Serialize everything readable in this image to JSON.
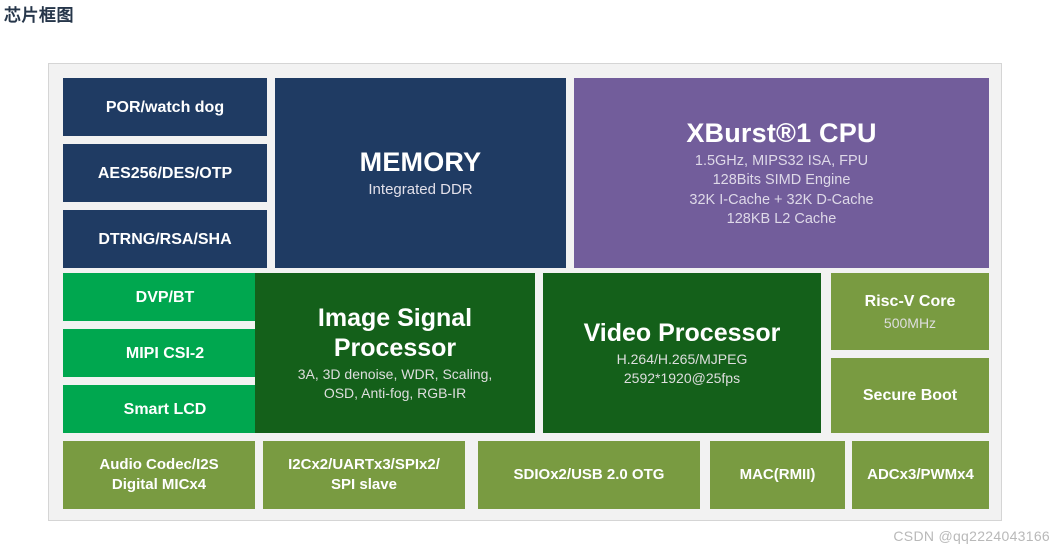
{
  "page": {
    "title": "芯片框图",
    "watermark": "CSDN @qq2224043166"
  },
  "colors": {
    "navy": "#1f3b63",
    "green": "#00a74f",
    "dark_green": "#14601a",
    "purple": "#725d9b",
    "olive": "#799b41",
    "canvas": "#f2f2f2",
    "title_text": "#26364a",
    "watermark_text": "#b9b9b9"
  },
  "diagram": {
    "left_security_blocks": [
      {
        "label": "POR/watch dog"
      },
      {
        "label": "AES256/DES/OTP"
      },
      {
        "label": "DTRNG/RSA/SHA"
      }
    ],
    "left_interface_blocks": [
      {
        "label": "DVP/BT"
      },
      {
        "label": "MIPI CSI-2"
      },
      {
        "label": "Smart LCD"
      }
    ],
    "memory": {
      "title": "MEMORY",
      "subtitle": "Integrated DDR"
    },
    "cpu": {
      "title": "XBurst®1 CPU",
      "specs": [
        "1.5GHz, MIPS32 ISA, FPU",
        "128Bits SIMD Engine",
        "32K I-Cache + 32K D-Cache",
        "128KB L2 Cache"
      ]
    },
    "isp": {
      "title_line1": "Image Signal",
      "title_line2": "Processor",
      "specs": [
        "3A, 3D denoise, WDR, Scaling,",
        "OSD, Anti-fog, RGB-IR"
      ]
    },
    "video": {
      "title": "Video Processor",
      "specs": [
        "H.264/H.265/MJPEG",
        "2592*1920@25fps"
      ]
    },
    "riscv": {
      "title": "Risc-V Core",
      "subtitle": "500MHz"
    },
    "secure_boot": {
      "title": "Secure Boot"
    },
    "peripheral_blocks": [
      {
        "line1": "Audio Codec/I2S",
        "line2": "Digital MICx4"
      },
      {
        "line1": "I2Cx2/UARTx3/SPIx2/",
        "line2": "SPI slave"
      },
      {
        "line1": "SDIOx2/USB 2.0 OTG",
        "line2": ""
      },
      {
        "line1": "MAC(RMII)",
        "line2": ""
      },
      {
        "line1": "ADCx3/PWMx4",
        "line2": ""
      }
    ]
  }
}
